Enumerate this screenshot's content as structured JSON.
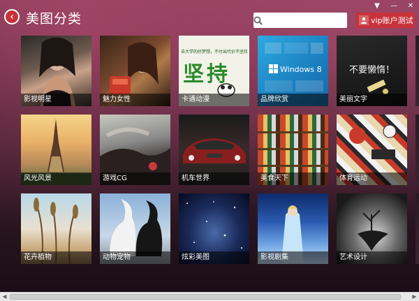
{
  "header": {
    "title": "美图分类",
    "back_icon": "‹",
    "search_placeholder": "",
    "account_label": "vip账户测试"
  },
  "window_controls": {
    "menu": "▼",
    "minimize": "—",
    "close": "✕"
  },
  "tiles": [
    {
      "label": "影视明星"
    },
    {
      "label": "魅力女性"
    },
    {
      "label": "卡通动漫"
    },
    {
      "label": "品牌欣赏"
    },
    {
      "label": "美丽文字"
    },
    {
      "label": "风光风景"
    },
    {
      "label": "游戏CG"
    },
    {
      "label": "机车世界"
    },
    {
      "label": "美食天下"
    },
    {
      "label": "体育运动"
    },
    {
      "label": "花卉植物"
    },
    {
      "label": "动物宠物"
    },
    {
      "label": "炫彩美图"
    },
    {
      "label": "影视剧集"
    },
    {
      "label": "艺术设计"
    }
  ],
  "tile_art_text": {
    "cartoon_top": "去大学的好梦想，不付出代价不坚持",
    "cartoon_big": "坚持",
    "brand": "Windows 8",
    "text_art": "不要懒惰！"
  },
  "colors": {
    "accent": "#c8323a"
  }
}
